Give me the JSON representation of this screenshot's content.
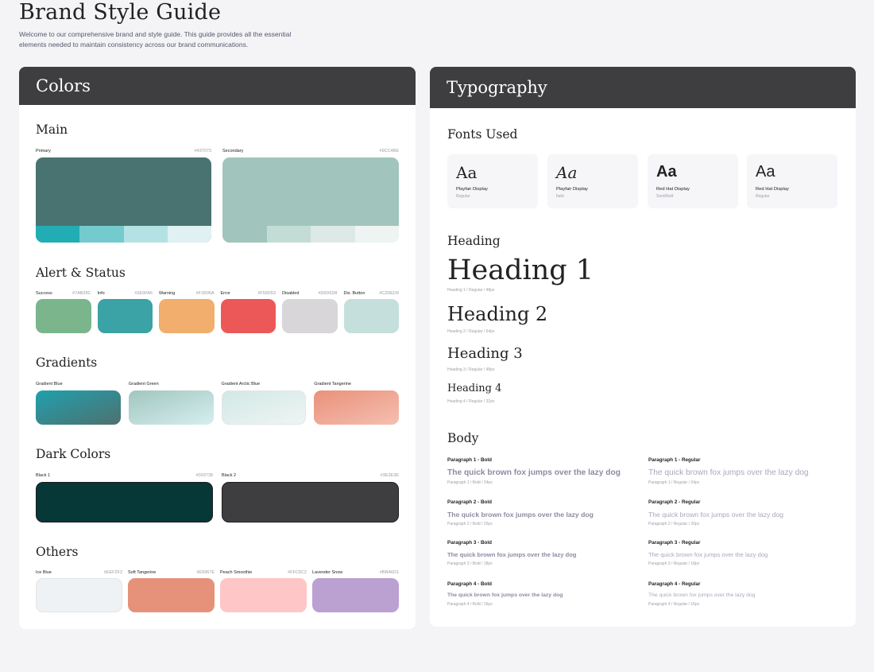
{
  "page": {
    "title": "Brand Style Guide",
    "intro": "Welcome to our comprehensive brand and style guide. This guide provides all the essential elements needed to maintain consistency across our brand communications."
  },
  "colors": {
    "header": "Colors",
    "main": {
      "title": "Main",
      "primary": {
        "label": "Primary",
        "hex": "#437073",
        "color": "#497370",
        "tints": [
          "#22adb5",
          "#73cbcd",
          "#b4e2e4",
          "#dff1f2"
        ]
      },
      "secondary": {
        "label": "Secondary",
        "hex": "#9CC4BE",
        "color": "#a1c5bc",
        "tints": [
          "#a1c5bc",
          "#c3dcd6",
          "#dde9e6",
          "#eef4f2"
        ]
      }
    },
    "alert": {
      "title": "Alert & Status",
      "items": [
        {
          "label": "Success",
          "hex": "#7AB28C",
          "color": "#7ab58c"
        },
        {
          "label": "Info",
          "hex": "#3E9FA6",
          "color": "#3ba2a5"
        },
        {
          "label": "Warning",
          "hex": "#F1B06A",
          "color": "#f1ae6c"
        },
        {
          "label": "Error",
          "hex": "#F55D53",
          "color": "#ec5857"
        },
        {
          "label": "Disabled",
          "hex": "#D6D6D8",
          "color": "#d8d6d9"
        },
        {
          "label": "Dis. Button",
          "hex": "#C2DED9",
          "color": "#c5e0dc"
        }
      ]
    },
    "gradients": {
      "title": "Gradients",
      "items": [
        {
          "label": "Gradient Blue",
          "from": "#1fa1ad",
          "to": "#4e7070"
        },
        {
          "label": "Gradient Green",
          "from": "#a0c6be",
          "to": "#d7eef0"
        },
        {
          "label": "Gradient Arctic Blue",
          "from": "#d2e8e5",
          "to": "#eef5f3"
        },
        {
          "label": "Gradient Tangerine",
          "from": "#e9917a",
          "to": "#f5bfb0"
        }
      ]
    },
    "dark": {
      "title": "Dark Colors",
      "items": [
        {
          "label": "Black 1",
          "hex": "#003738",
          "color": "#063838"
        },
        {
          "label": "Black 2",
          "hex": "#3E3E3E",
          "color": "#3e3d40"
        }
      ]
    },
    "others": {
      "title": "Others",
      "items": [
        {
          "label": "Ice Blue",
          "hex": "#EEF2F2",
          "color": "#eef2f4"
        },
        {
          "label": "Soft Tangerine",
          "hex": "#E5967E",
          "color": "#e6927b"
        },
        {
          "label": "Peach Smoothie",
          "hex": "#FFC5C2",
          "color": "#fec6c6"
        },
        {
          "label": "Lavender Snow",
          "hex": "#BBA6D1",
          "color": "#bba0d2"
        }
      ]
    }
  },
  "typography": {
    "header": "Typography",
    "fonts_title": "Fonts Used",
    "fonts": [
      {
        "sample": "Aa",
        "name": "Playfair Display",
        "style": "Regular"
      },
      {
        "sample": "Aa",
        "name": "Playfair Display",
        "style": "Italic"
      },
      {
        "sample": "Aa",
        "name": "Red Hat Display",
        "style": "SemiBold"
      },
      {
        "sample": "Aa",
        "name": "Red Hat Display",
        "style": "Regular"
      }
    ],
    "heading_title": "Heading",
    "headings": [
      {
        "text": "Heading 1",
        "meta": "Heading 1 / Regular / 48px"
      },
      {
        "text": "Heading 2",
        "meta": "Heading 2 / Regular / 64px"
      },
      {
        "text": "Heading 3",
        "meta": "Heading 3 / Regular / 48px"
      },
      {
        "text": "Heading 4",
        "meta": "Heading 4 / Regular / 32px"
      }
    ],
    "body_title": "Body",
    "sample_text": "The quick brown fox jumps over the lazy dog",
    "paragraphs": [
      {
        "bold_label": "Paragraph 1 - Bold",
        "bold_meta": "Paragraph 1 / Bold / 24px",
        "reg_label": "Paragraph 1 - Regular",
        "reg_meta": "Paragraph 1 / Regular / 24px"
      },
      {
        "bold_label": "Paragraph 2 - Bold",
        "bold_meta": "Paragraph 2 / Bold / 20px",
        "reg_label": "Paragraph 2 - Regular",
        "reg_meta": "Paragraph 2 / Regular / 20px"
      },
      {
        "bold_label": "Paragraph 3 - Bold",
        "bold_meta": "Paragraph 3 / Bold / 18px",
        "reg_label": "Paragraph 3 - Regular",
        "reg_meta": "Paragraph 3 / Regular / 18px"
      },
      {
        "bold_label": "Paragraph 4 - Bold",
        "bold_meta": "Paragraph 4 / Bold / 16px",
        "reg_label": "Paragraph 4 - Regular",
        "reg_meta": "Paragraph 4 / Regular / 16px"
      }
    ]
  }
}
